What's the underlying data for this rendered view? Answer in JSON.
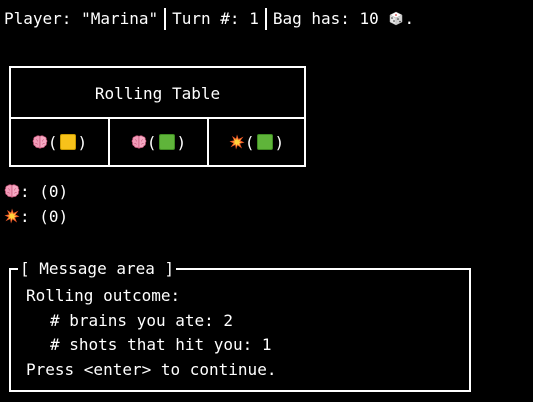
{
  "status": {
    "player_text": "Player: \"Marina\"",
    "turn_text": "Turn #: 1",
    "bag_text": "Bag has: 10",
    "bag_suffix": "."
  },
  "rolling_table": {
    "title": "Rolling Table",
    "cells": [
      {
        "face_icon": "brain-icon",
        "die_color": "yellow"
      },
      {
        "face_icon": "brain-icon",
        "die_color": "green"
      },
      {
        "face_icon": "explosion-icon",
        "die_color": "green"
      }
    ]
  },
  "counters": {
    "brains_value": ": (0)",
    "shots_value": ": (0)"
  },
  "message_area": {
    "title": "[ Message area ]",
    "lines": [
      "Rolling outcome:",
      "# brains you ate: 2",
      "# shots that hit you: 1",
      "Press <enter> to continue."
    ]
  },
  "colors": {
    "background": "#000000",
    "foreground": "#ffffff",
    "die_yellow": "#f7c21a",
    "die_green": "#5fb43a"
  }
}
